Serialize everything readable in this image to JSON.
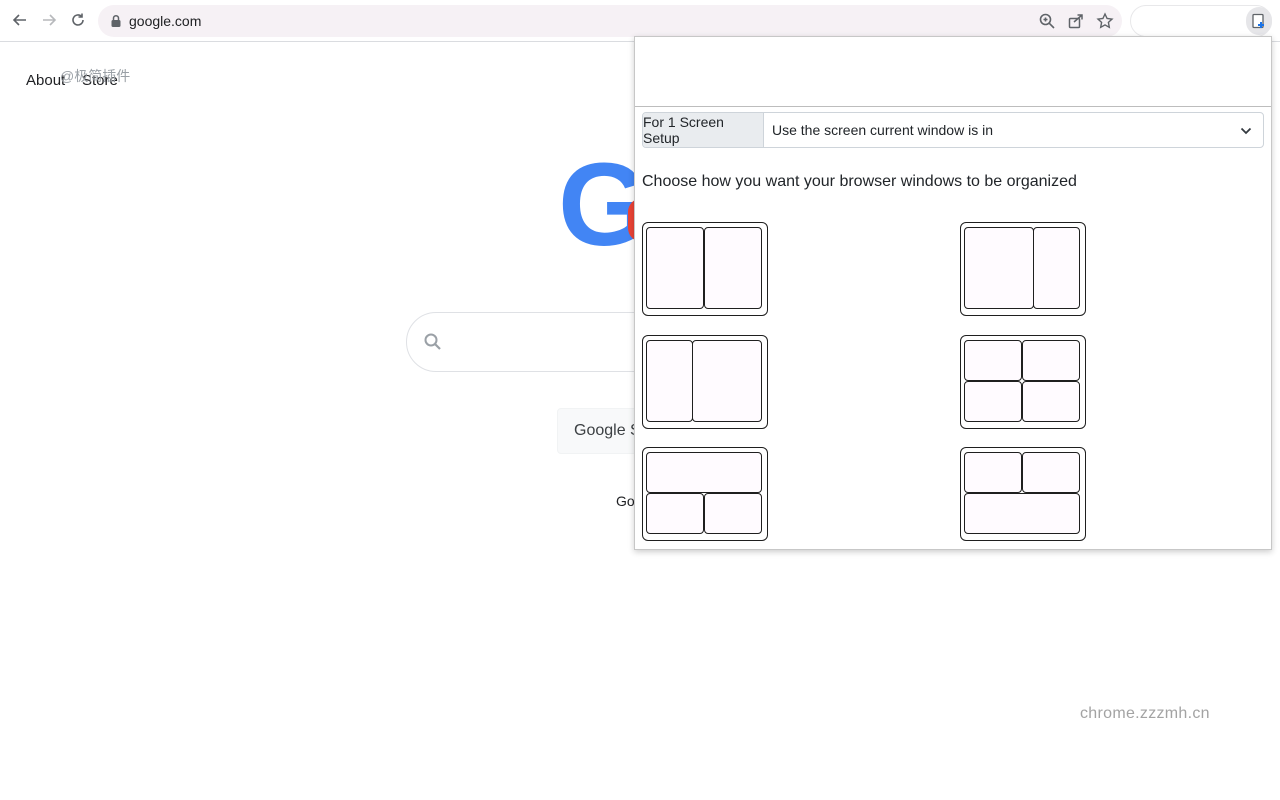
{
  "browser": {
    "url": "google.com"
  },
  "google": {
    "about": "About",
    "store": "Store",
    "logo_letter": "G",
    "search_button": "Google Se",
    "offered_in": "Goo"
  },
  "watermarks": {
    "top": "@极简插件",
    "bottom": "chrome.zzzmh.cn"
  },
  "popup": {
    "setup_label": "For 1 Screen Setup",
    "screen_select": "Use the screen current window is in",
    "instruction": "Choose how you want your browser windows to be organized",
    "layouts": [
      {
        "id": "two-equal-columns"
      },
      {
        "id": "wide-left-narrow-right"
      },
      {
        "id": "narrow-left-wide-right"
      },
      {
        "id": "four-quadrants"
      },
      {
        "id": "top-full-bottom-two"
      },
      {
        "id": "top-two-bottom-full"
      }
    ]
  },
  "colors": {
    "google_blue": "#4285f4",
    "google_red": "#ea4335",
    "omnibox_bg": "#f6f1f5",
    "pane_bg": "#fffbff"
  }
}
